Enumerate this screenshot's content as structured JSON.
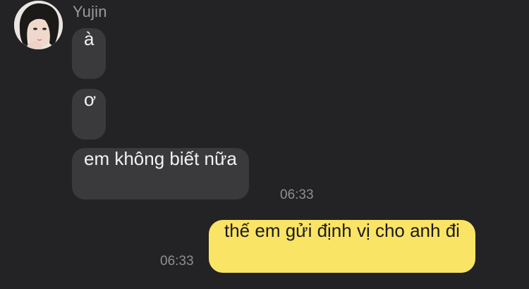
{
  "contact": {
    "name": "Yujin",
    "avatar": "user-avatar"
  },
  "messages": [
    {
      "direction": "incoming",
      "text": "à",
      "time": ""
    },
    {
      "direction": "incoming",
      "text": "ơ",
      "time": ""
    },
    {
      "direction": "incoming",
      "text": "em không biết nữa",
      "time": "06:33"
    },
    {
      "direction": "outgoing",
      "text": "thế em gửi định vị cho anh đi",
      "time": "06:33"
    }
  ],
  "colors": {
    "background": "#232325",
    "incoming_bubble": "#3a3a3d",
    "outgoing_bubble": "#fae466",
    "name_text": "#9a9a9e",
    "time_text": "#8f8f93"
  }
}
